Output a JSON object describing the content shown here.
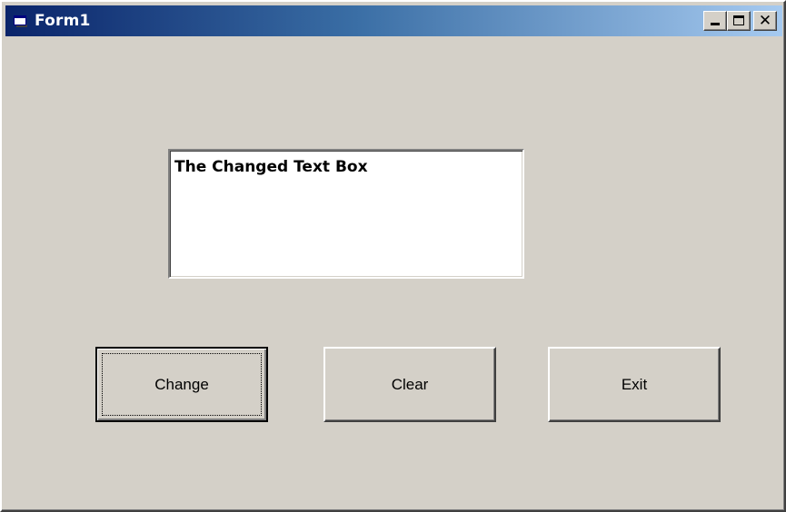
{
  "window": {
    "title": "Form1",
    "icon": "form-window-icon",
    "controls": {
      "minimize": "minimize-icon",
      "maximize": "maximize-icon",
      "close": "close-icon",
      "close_glyph": "✕"
    }
  },
  "textbox": {
    "value": "The Changed Text Box"
  },
  "buttons": {
    "change": "Change",
    "clear": "Clear",
    "exit": "Exit"
  },
  "colors": {
    "face": "#d4d0c8",
    "titlebar_start": "#0a246a",
    "titlebar_end": "#a6caf0"
  }
}
